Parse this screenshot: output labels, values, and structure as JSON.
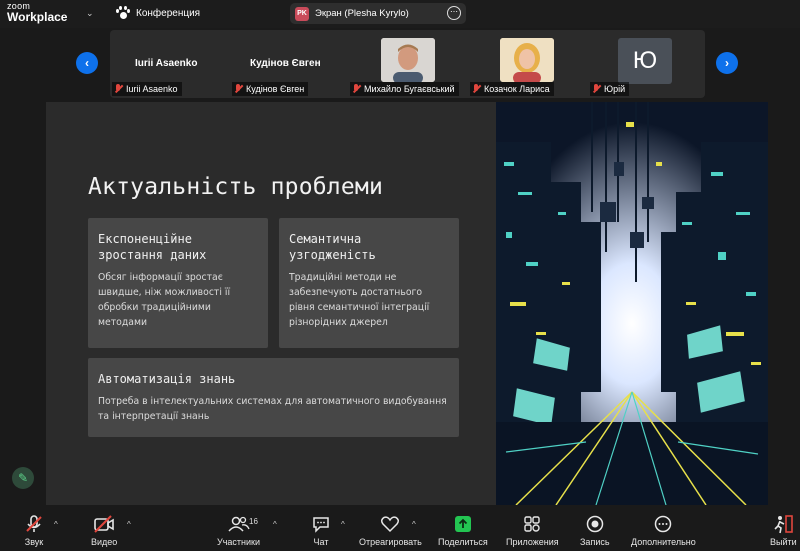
{
  "app": {
    "logo_top": "zoom",
    "logo_bottom": "Workplace",
    "conference_label": "Конференция"
  },
  "share": {
    "badge": "PK",
    "label": "Экран (Plesha Kyrylo)"
  },
  "participants": [
    {
      "big_name": "Iurii Asaenko",
      "tag": "Iurii Asaenko"
    },
    {
      "big_name": "Кудінов Євген",
      "tag": "Кудінов Євген"
    },
    {
      "tag": "Михайло Бугаєвський"
    },
    {
      "tag": "Козачок Лариса"
    },
    {
      "avatar_letter": "Ю",
      "tag": "Юрій"
    }
  ],
  "slide": {
    "title": "Актуальність проблеми",
    "cards": [
      {
        "title": "Експоненційне зростання даних",
        "body": "Обсяг інформації зростає швидше, ніж можливості її обробки традиційними методами"
      },
      {
        "title": "Семантична узгодженість",
        "body": "Традиційні методи не забезпечують достатнього рівня семантичної інтеграції різнорідних джерел"
      },
      {
        "title": "Автоматизація знань",
        "body": "Потреба в інтелектуальних системах для автоматичного видобування та інтерпретації знань"
      }
    ]
  },
  "toolbar": {
    "audio": "Звук",
    "video": "Видео",
    "participants": "Участники",
    "participants_count": "16",
    "chat": "Чат",
    "react": "Отреагировать",
    "share": "Поделиться",
    "apps": "Приложения",
    "record": "Запись",
    "more": "Дополнительно",
    "leave": "Выйти"
  },
  "colors": {
    "accent": "#0e71eb",
    "share_green": "#23c552",
    "muted_red": "#e0463d"
  }
}
